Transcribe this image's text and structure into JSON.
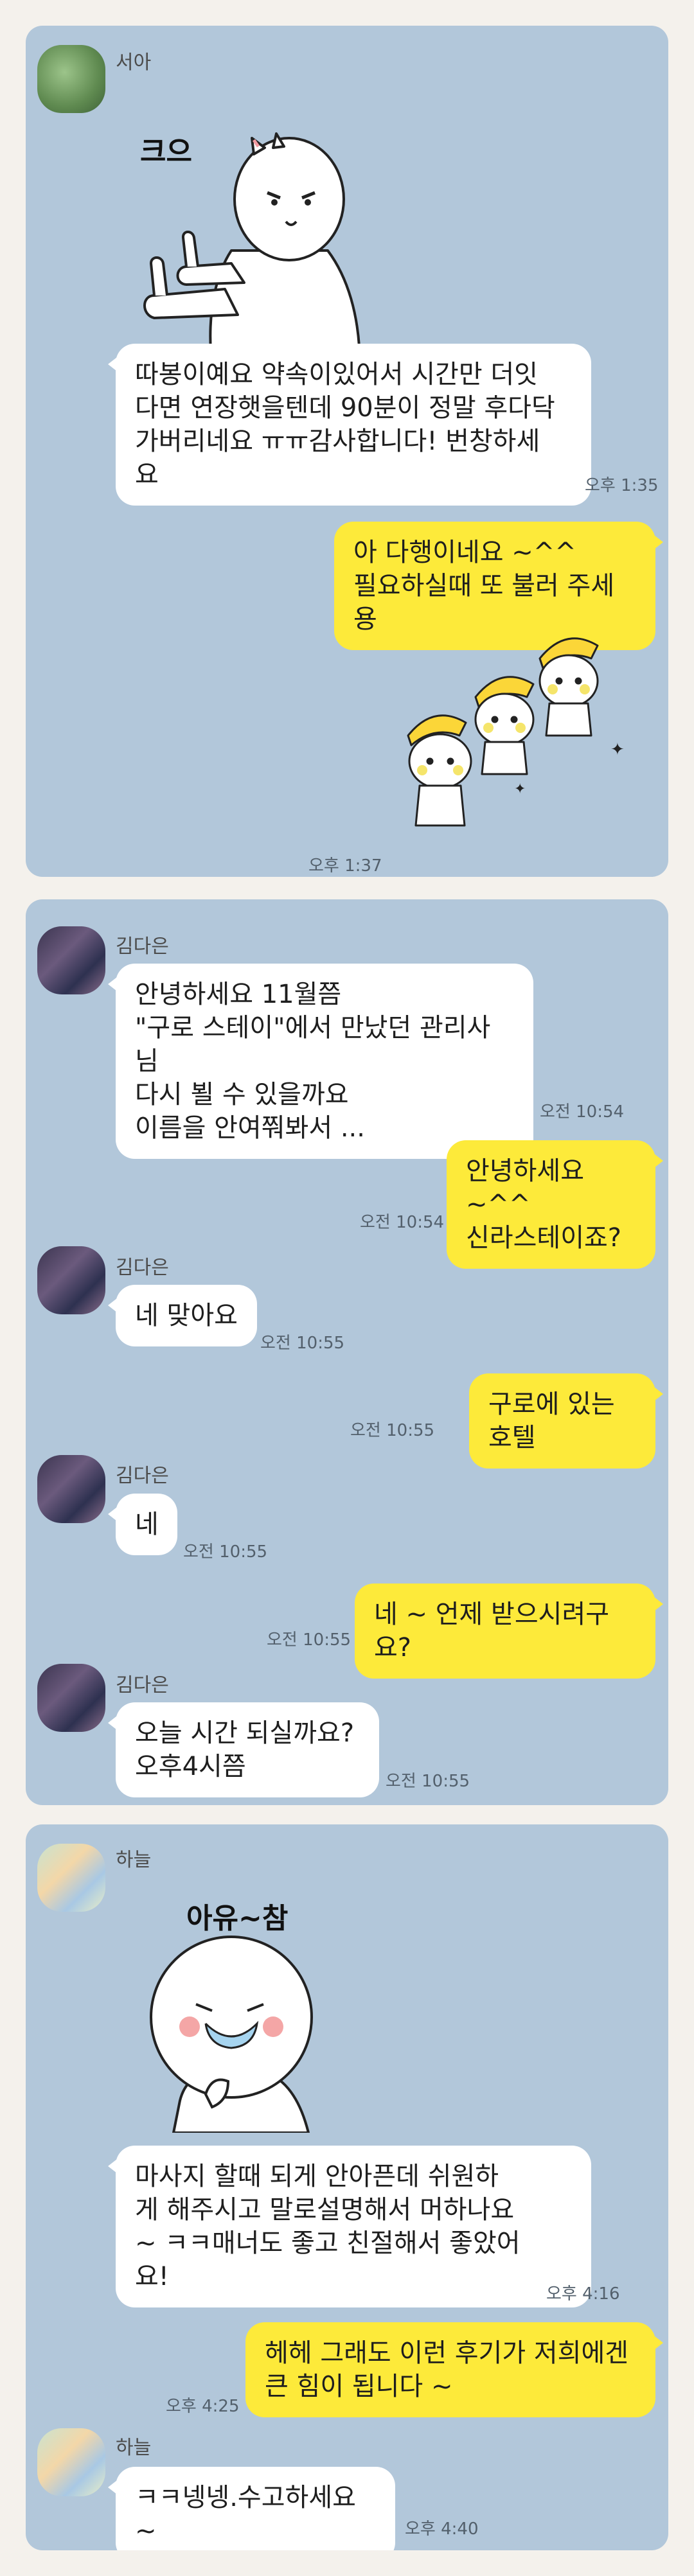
{
  "chat1": {
    "sender": "서아",
    "sticker_caption": "크으",
    "message": "따봉이예요 약속이있어서 시간만 더잇\n다면 연장햇을텐데 90분이 정말 후다닥\n가버리네요 ㅠㅠ감사합니다! 번창하세\n요",
    "message_time": "오후 1:35",
    "reply": "아 다행이네요 ~^^\n필요하실때 또 불러 주세용",
    "reply_sticker_time": "오후 1:37"
  },
  "chat2": {
    "sender": "김다은",
    "messages": [
      {
        "text": "안녕하세요 11월쯤\n\"구로 스테이\"에서 만났던 관리사님\n다시 뵐 수 있을까요\n이름을 안여쭤봐서 ...",
        "time": "오전 10:54"
      },
      {
        "text": "안녕하세요 ~^^\n신라스테이죠?",
        "time": "오전 10:54"
      },
      {
        "text": "네 맞아요",
        "time": "오전 10:55"
      },
      {
        "text": "구로에 있는 호텔",
        "time": "오전 10:55"
      },
      {
        "text": "네",
        "time": "오전 10:55"
      },
      {
        "text": "네 ~ 언제 받으시려구요?",
        "time": "오전 10:55"
      },
      {
        "text": "오늘  시간 되실까요?\n오후4시쯤",
        "time": "오전 10:55"
      }
    ]
  },
  "chat3": {
    "sender": "하늘",
    "sticker_caption": "아유~참",
    "message": "마사지 할때 되게 안아픈데 쉬원하\n게 해주시고 말로설명해서 머하나요\n~ ㅋㅋ매너도 좋고 친절해서 좋았어\n요!",
    "message_time": "오후 4:16",
    "reply": "헤헤 그래도 이런 후기가 저희에겐\n큰 힘이 됩니다 ~",
    "reply_time": "오후 4:25",
    "sender2": "하늘",
    "last_message": "ㅋㅋ넹넹.수고하세요~",
    "last_time": "오후 4:40"
  },
  "colors": {
    "chat_bg": "#b2c7da",
    "incoming_bubble": "#ffffff",
    "outgoing_bubble": "#fdea3a",
    "page_bg": "#f4f1ec"
  }
}
